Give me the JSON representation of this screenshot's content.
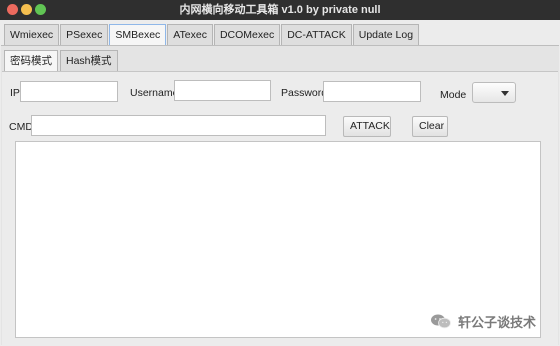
{
  "window": {
    "title": "内网横向移动工具箱 v1.0   by private null"
  },
  "tabs": [
    {
      "label": "Wmiexec",
      "active": false
    },
    {
      "label": "PSexec",
      "active": false
    },
    {
      "label": "SMBexec",
      "active": true
    },
    {
      "label": "ATexec",
      "active": false
    },
    {
      "label": "DCOMexec",
      "active": false
    },
    {
      "label": "DC-ATTACK",
      "active": false
    },
    {
      "label": "Update Log",
      "active": false
    }
  ],
  "subtabs": [
    {
      "label": "密码模式",
      "active": true
    },
    {
      "label": "Hash模式",
      "active": false
    }
  ],
  "form": {
    "ip_label": "IP",
    "ip_value": "",
    "username_label": "Username",
    "username_value": "",
    "password_label": "Password",
    "password_value": "",
    "mode_label": "Mode",
    "mode_value": "",
    "cmd_label": "CMD",
    "cmd_value": "",
    "attack_label": "ATTACK",
    "clear_label": "Clear"
  },
  "output": {
    "text": ""
  },
  "watermark": {
    "text": "轩公子谈技术"
  }
}
